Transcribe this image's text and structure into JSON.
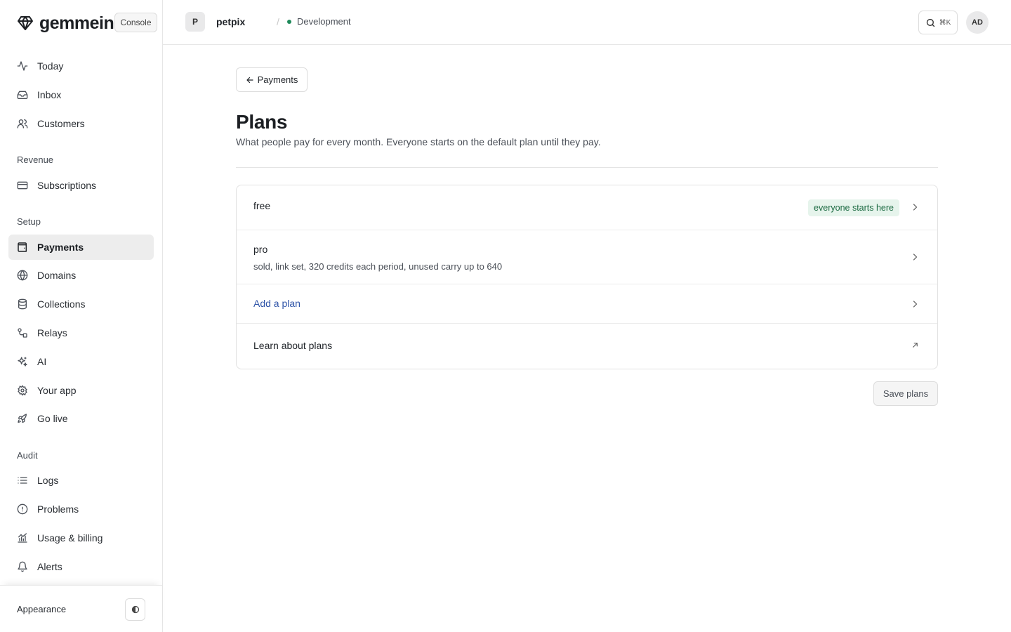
{
  "app": {
    "brand": "gemmein",
    "console_label": "Console"
  },
  "sidebar": {
    "items_top": [
      {
        "label": "Today",
        "icon": "pulse-icon"
      },
      {
        "label": "Inbox",
        "icon": "inbox-icon"
      },
      {
        "label": "Customers",
        "icon": "users-icon"
      }
    ],
    "section_revenue": "Revenue",
    "items_revenue": [
      {
        "label": "Subscriptions",
        "icon": "credit-card-icon"
      }
    ],
    "section_setup": "Setup",
    "items_setup": [
      {
        "label": "Payments",
        "icon": "wallet-icon",
        "active": true
      },
      {
        "label": "Domains",
        "icon": "globe-icon"
      },
      {
        "label": "Collections",
        "icon": "database-icon"
      },
      {
        "label": "Relays",
        "icon": "relay-icon"
      },
      {
        "label": "AI",
        "icon": "sparkles-icon"
      },
      {
        "label": "Your app",
        "icon": "gear-icon"
      },
      {
        "label": "Go live",
        "icon": "rocket-icon"
      }
    ],
    "section_audit": "Audit",
    "items_audit": [
      {
        "label": "Logs",
        "icon": "list-icon"
      },
      {
        "label": "Problems",
        "icon": "alert-circle-icon"
      },
      {
        "label": "Usage & billing",
        "icon": "chart-icon"
      },
      {
        "label": "Alerts",
        "icon": "bell-icon"
      }
    ],
    "appearance_label": "Appearance"
  },
  "topbar": {
    "project_initial": "P",
    "project_name": "petpix",
    "separator": "/",
    "environment": "Development",
    "search_shortcut": "⌘K",
    "user_initials": "AD"
  },
  "main": {
    "back_label": "Payments",
    "title": "Plans",
    "subtitle": "What people pay for every month. Everyone starts on the default plan until they pay.",
    "plans": [
      {
        "name": "free",
        "tag": "everyone starts here"
      },
      {
        "name": "pro",
        "description": "sold, link set, 320 credits each period, unused carry up to 640"
      }
    ],
    "add_plan_label": "Add a plan",
    "learn_label": "Learn about plans",
    "save_label": "Save plans"
  },
  "colors": {
    "active_bg": "#ededed",
    "link": "#2f54a8",
    "tag_bg": "#e6f4ec",
    "tag_text": "#1d6b43",
    "env_dot": "#1f8a5b"
  }
}
